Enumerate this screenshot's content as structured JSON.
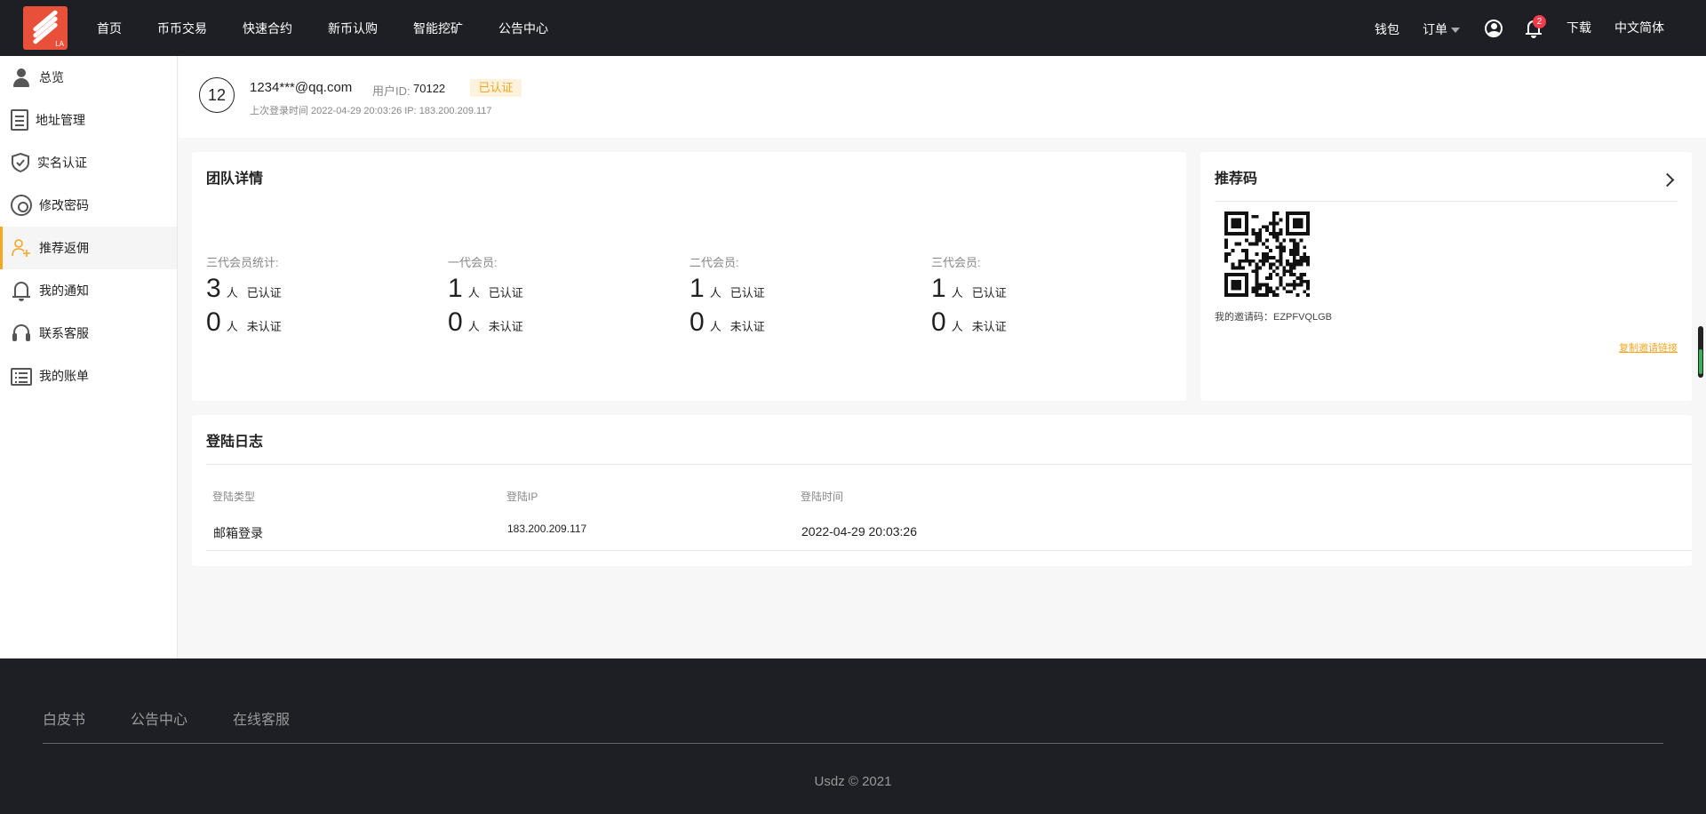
{
  "nav": {
    "links": [
      "首页",
      "币币交易",
      "快速合约",
      "新币认购",
      "智能挖矿",
      "公告中心"
    ],
    "wallet": "钱包",
    "orders": "订单",
    "notification_count": "2",
    "download": "下载",
    "language": "中文简体",
    "logo_text": "LA"
  },
  "sidebar": {
    "items": [
      {
        "label": "总览",
        "icon": "person-icon"
      },
      {
        "label": "地址管理",
        "icon": "document-icon"
      },
      {
        "label": "实名认证",
        "icon": "shield-icon"
      },
      {
        "label": "修改密码",
        "icon": "gear-icon"
      },
      {
        "label": "推荐返佣",
        "icon": "add-user-icon",
        "active": true
      },
      {
        "label": "我的通知",
        "icon": "bell-icon"
      },
      {
        "label": "联系客服",
        "icon": "headset-icon"
      },
      {
        "label": "我的账单",
        "icon": "list-icon"
      }
    ]
  },
  "profile": {
    "avatar_text": "12",
    "email": "1234***@qq.com",
    "uid_label": "用户ID:",
    "uid": "70122",
    "status": "已认证",
    "last_login": "上次登录时间 2022-04-29 20:03:26   IP: 183.200.209.117"
  },
  "team": {
    "title": "团队详情",
    "unit": "人",
    "verified_label": "已认证",
    "unverified_label": "未认证",
    "columns": [
      {
        "label": "三代会员统计:",
        "verified": "3",
        "unverified": "0"
      },
      {
        "label": "一代会员:",
        "verified": "1",
        "unverified": "0"
      },
      {
        "label": "二代会员:",
        "verified": "1",
        "unverified": "0"
      },
      {
        "label": "三代会员:",
        "verified": "1",
        "unverified": "0"
      }
    ]
  },
  "referral": {
    "title": "推荐码",
    "invite_code": "我的邀请码：EZPFVQLGB",
    "copy_link": "复制邀请链接"
  },
  "login_log": {
    "title": "登陆日志",
    "headers": [
      "登陆类型",
      "登陆IP",
      "登陆时间"
    ],
    "rows": [
      {
        "type": "邮箱登录",
        "ip": "183.200.209.117",
        "time": "2022-04-29 20:03:26"
      }
    ]
  },
  "footer": {
    "links": [
      "白皮书",
      "公告中心",
      "在线客服"
    ],
    "copyright": "Usdz © 2021"
  },
  "colors": {
    "dark_bg": "#1e1f24",
    "accent": "#f5a623",
    "brand": "#e8503a",
    "badge": "#f23c4c"
  }
}
